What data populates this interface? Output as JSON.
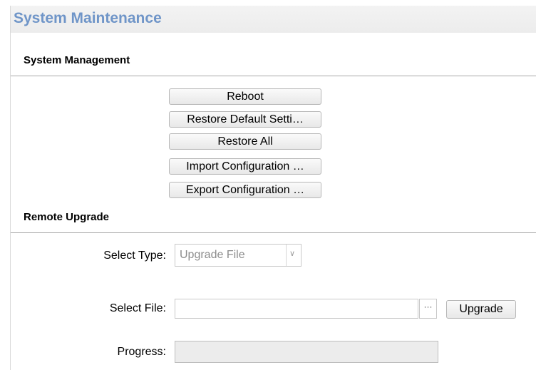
{
  "page": {
    "title": "System Maintenance"
  },
  "system_management": {
    "title": "System Management",
    "buttons": [
      "Reboot",
      "Restore Default Setti…",
      "Restore All",
      "Import Configuration …",
      "Export Configuration …"
    ]
  },
  "remote_upgrade": {
    "title": "Remote Upgrade",
    "select_type_label": "Select Type:",
    "select_type_value": "Upgrade File",
    "select_file_label": "Select File:",
    "file_value": "",
    "browse_label": "···",
    "upgrade_label": "Upgrade",
    "progress_label": "Progress:",
    "progress_value": 0
  },
  "icons": {
    "dropdown": "chevron-down-icon",
    "browse": "ellipsis-icon"
  },
  "colors": {
    "accent": "#6f95c8",
    "header_bg": "#eeeeee",
    "divider": "#a8a8a8"
  }
}
